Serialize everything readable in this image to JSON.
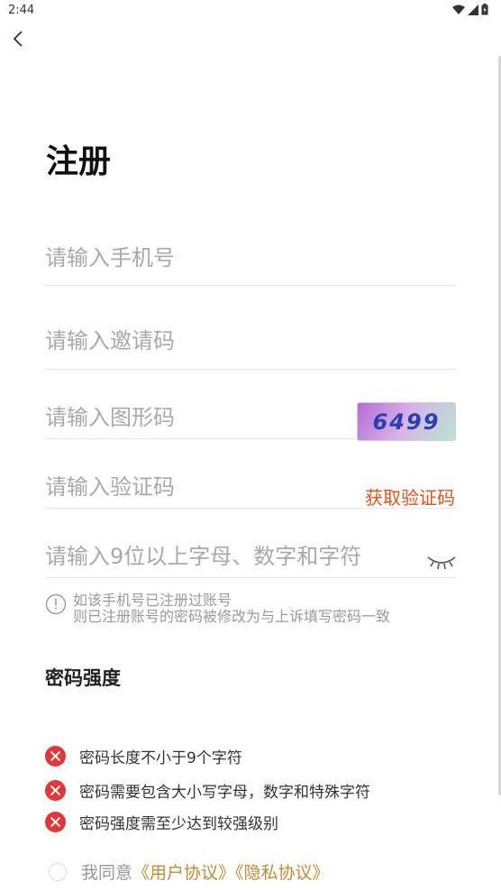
{
  "status_bar": {
    "time": "2:44"
  },
  "header": {
    "title": "注册"
  },
  "form": {
    "phone_placeholder": "请输入手机号",
    "invite_placeholder": "请输入邀请码",
    "captcha_placeholder": "请输入图形码",
    "captcha_image_text": "6499",
    "sms_placeholder": "请输入验证码",
    "get_code_label": "获取验证码",
    "password_placeholder": "请输入9位以上字母、数字和字符"
  },
  "notice": {
    "line1": "如该手机号已注册过账号",
    "line2": "则已注册账号的密码被修改为与上诉填写密码一致"
  },
  "strength": {
    "title": "密码强度",
    "rules": [
      "密码长度不小于9个字符",
      "密码需要包含大小写字母，数字和特殊字符",
      "密码强度需至少达到较强级别"
    ]
  },
  "agreement": {
    "prefix": "我同意",
    "user_agreement": "《用户协议》",
    "privacy_policy": "《隐私协议》"
  },
  "colors": {
    "accent": "#e1521e",
    "link": "#c48a3c",
    "error": "#e0373a"
  }
}
